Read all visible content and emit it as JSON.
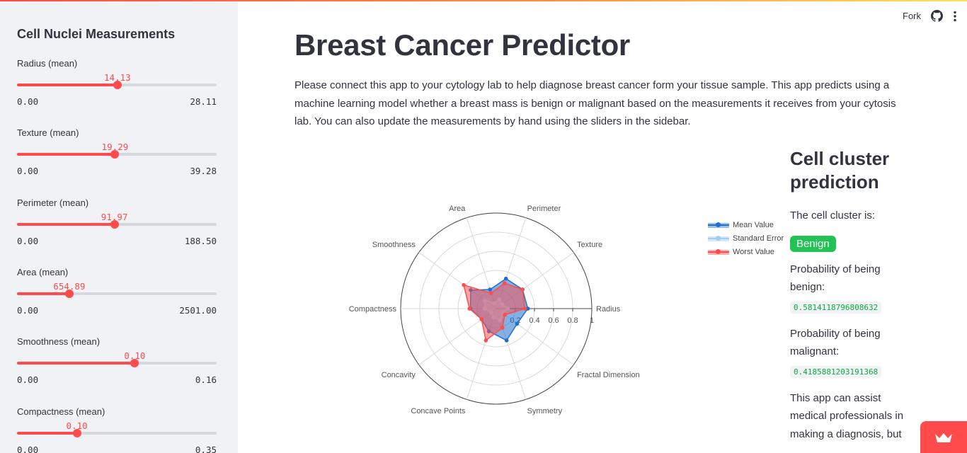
{
  "header": {
    "fork_label": "Fork"
  },
  "sidebar": {
    "title": "Cell Nuclei Measurements",
    "sliders": [
      {
        "label": "Radius (mean)",
        "value": "14.13",
        "min": "0.00",
        "max": "28.11",
        "fraction": 0.503
      },
      {
        "label": "Texture (mean)",
        "value": "19.29",
        "min": "0.00",
        "max": "39.28",
        "fraction": 0.491
      },
      {
        "label": "Perimeter (mean)",
        "value": "91.97",
        "min": "0.00",
        "max": "188.50",
        "fraction": 0.488
      },
      {
        "label": "Area (mean)",
        "value": "654.89",
        "min": "0.00",
        "max": "2501.00",
        "fraction": 0.262
      },
      {
        "label": "Smoothness (mean)",
        "value": "0.10",
        "min": "0.00",
        "max": "0.16",
        "fraction": 0.59
      },
      {
        "label": "Compactness (mean)",
        "value": "0.10",
        "min": "0.00",
        "max": "0.35",
        "fraction": 0.3
      }
    ]
  },
  "main": {
    "title": "Breast Cancer Predictor",
    "intro": "Please connect this app to your cytology lab to help diagnose breast cancer form your tissue sample. This app predicts using a machine learning model whether a breast mass is benign or malignant based on the measurements it receives from your cytosis lab. You can also update the measurements by hand using the sliders in the sidebar."
  },
  "chart_data": {
    "type": "radar",
    "categories": [
      "Radius",
      "Texture",
      "Perimeter",
      "Area",
      "Smoothness",
      "Compactness",
      "Concavity",
      "Concave Points",
      "Symmetry",
      "Fractal Dimension"
    ],
    "radial_ticks": [
      "0.2",
      "0.4",
      "0.6",
      "0.8",
      "1"
    ],
    "range": [
      0,
      1
    ],
    "series": [
      {
        "name": "Mean Value",
        "color": "#1f6fcc",
        "values": [
          0.33,
          0.34,
          0.33,
          0.21,
          0.33,
          0.27,
          0.19,
          0.25,
          0.35,
          0.27
        ]
      },
      {
        "name": "Standard Error",
        "color": "#9fcdf5",
        "values": [
          0.12,
          0.08,
          0.1,
          0.06,
          0.15,
          0.12,
          0.07,
          0.1,
          0.13,
          0.09
        ]
      },
      {
        "name": "Worst Value",
        "color": "#ff4b4b",
        "values": [
          0.3,
          0.34,
          0.28,
          0.17,
          0.42,
          0.28,
          0.19,
          0.35,
          0.21,
          0.11
        ]
      }
    ]
  },
  "prediction": {
    "title": "Cell cluster prediction",
    "cluster_label": "The cell cluster is:",
    "result": "Benign",
    "benign_label": "Probability of being benign:",
    "benign_value": "0.5814118796808632",
    "malignant_label": "Probability of being malignant:",
    "malignant_value": "0.4185881203191368",
    "disclaimer": "This app can assist medical professionals in making a diagnosis, but"
  },
  "colors": {
    "accent": "#ff4b4b",
    "benign": "#21c354",
    "sidebar_bg": "#f0f2f6"
  },
  "icons": [
    "github-icon",
    "more-vertical-icon",
    "crown-icon"
  ]
}
